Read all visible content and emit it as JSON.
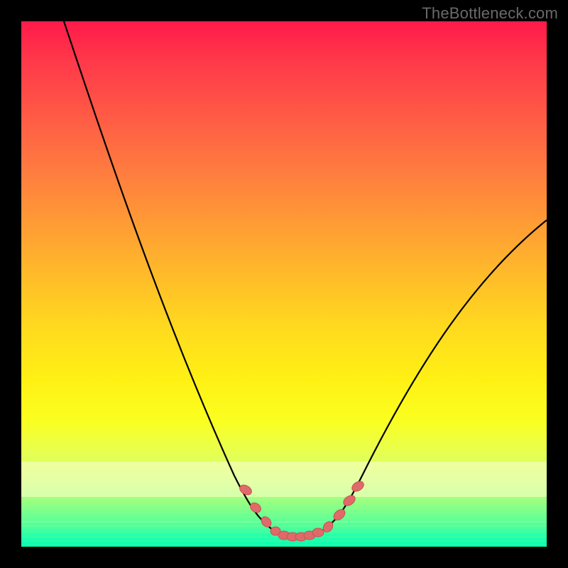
{
  "watermark": "TheBottleneck.com",
  "colors": {
    "frame": "#000000",
    "curve": "#000000",
    "marker_fill": "#e06a6a",
    "marker_stroke": "#c94f4f",
    "gradient_top": "#ff1a4a",
    "gradient_mid": "#ffd91f",
    "gradient_bottom": "#10ffb0"
  },
  "chart_data": {
    "type": "line",
    "title": "",
    "xlabel": "",
    "ylabel": "",
    "xlim": [
      0,
      100
    ],
    "ylim": [
      0,
      100
    ],
    "grid": false,
    "legend": false,
    "x": [
      0,
      5,
      10,
      15,
      20,
      25,
      30,
      35,
      40,
      42,
      44,
      46,
      48,
      50,
      52,
      54,
      56,
      58,
      60,
      65,
      70,
      75,
      80,
      85,
      90,
      95,
      100
    ],
    "values": [
      100,
      90,
      80,
      70,
      60,
      50,
      40,
      30,
      18,
      12,
      8,
      5,
      3,
      2,
      2,
      2,
      3,
      5,
      8,
      16,
      24,
      32,
      40,
      48,
      55,
      60,
      62
    ],
    "markers": {
      "x": [
        44,
        46,
        48,
        49,
        50,
        51,
        52,
        53,
        54,
        55,
        56,
        58,
        60,
        62
      ],
      "y": [
        9,
        6,
        4,
        3,
        3,
        3,
        3,
        3,
        3,
        3,
        4,
        6,
        9,
        12
      ]
    },
    "annotations": []
  }
}
